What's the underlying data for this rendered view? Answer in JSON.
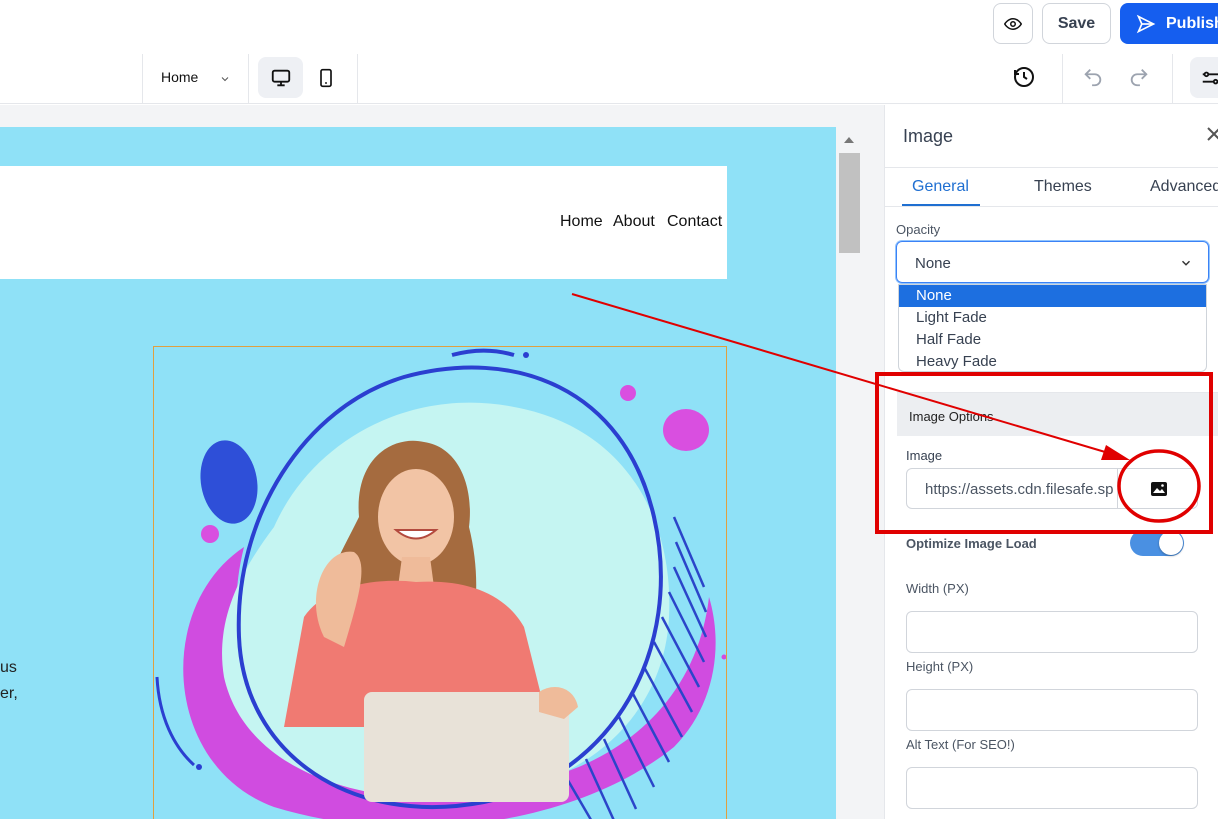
{
  "header": {
    "save_label": "Save",
    "publish_label": "Publish",
    "page_select": "Home"
  },
  "site": {
    "nav": [
      "Home",
      "About",
      "Contact"
    ],
    "body_fragments": [
      "us",
      "er,"
    ]
  },
  "panel": {
    "title": "Image",
    "tabs": [
      "General",
      "Themes",
      "Advanced"
    ],
    "opacity_label": "Opacity",
    "opacity_value": "None",
    "opacity_options": [
      "None",
      "Light Fade",
      "Half Fade",
      "Heavy Fade"
    ],
    "section_title": "Image Options",
    "image_label": "Image",
    "image_url": "https://assets.cdn.filesafe.sp",
    "optimize_label": "Optimize Image Load",
    "optimize_on": true,
    "width_label": "Width (PX)",
    "height_label": "Height (PX)",
    "alt_label": "Alt Text (For SEO!)"
  },
  "colors": {
    "accent": "#155eef",
    "canvas_bg": "#8fe1f7",
    "annotation": "#e00000"
  }
}
